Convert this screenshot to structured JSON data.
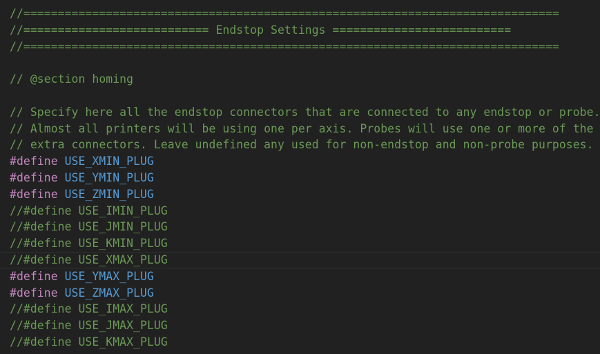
{
  "editor": {
    "background_color": "#212121",
    "comment_color": "#6a9955",
    "keyword_color": "#c586c0",
    "identifier_color": "#569cd6",
    "highlight_border_color": "#2c2f30",
    "section_title": "Endstop Settings",
    "section_tag": "// @section homing"
  },
  "lines": [
    {
      "id": "banner-top",
      "type": "comment",
      "text": "//=============================================================================="
    },
    {
      "id": "banner-title",
      "type": "comment",
      "text": "//=========================== Endstop Settings =========================="
    },
    {
      "id": "banner-bottom",
      "type": "comment",
      "text": "//=============================================================================="
    },
    {
      "id": "blank-1",
      "type": "blank",
      "text": " "
    },
    {
      "id": "section-homing",
      "type": "comment",
      "text": "// @section homing"
    },
    {
      "id": "blank-2",
      "type": "blank",
      "text": " "
    },
    {
      "id": "desc-1",
      "type": "comment",
      "text": "// Specify here all the endstop connectors that are connected to any endstop or probe."
    },
    {
      "id": "desc-2",
      "type": "comment",
      "text": "// Almost all printers will be using one per axis. Probes will use one or more of the"
    },
    {
      "id": "desc-3",
      "type": "comment",
      "text": "// extra connectors. Leave undefined any used for non-endstop and non-probe purposes."
    },
    {
      "id": "use-xmin-plug",
      "type": "define",
      "keyword": "#define",
      "identifier": "USE_XMIN_PLUG",
      "text": "#define USE_XMIN_PLUG"
    },
    {
      "id": "use-ymin-plug",
      "type": "define",
      "keyword": "#define",
      "identifier": "USE_YMIN_PLUG",
      "text": "#define USE_YMIN_PLUG"
    },
    {
      "id": "use-zmin-plug",
      "type": "define",
      "keyword": "#define",
      "identifier": "USE_ZMIN_PLUG",
      "text": "#define USE_ZMIN_PLUG"
    },
    {
      "id": "use-imin-plug",
      "type": "comment",
      "text": "//#define USE_IMIN_PLUG"
    },
    {
      "id": "use-jmin-plug",
      "type": "comment",
      "text": "//#define USE_JMIN_PLUG"
    },
    {
      "id": "use-kmin-plug",
      "type": "comment",
      "text": "//#define USE_KMIN_PLUG"
    },
    {
      "id": "use-xmax-plug",
      "type": "comment",
      "highlight": true,
      "text": "//#define USE_XMAX_PLUG"
    },
    {
      "id": "use-ymax-plug",
      "type": "define",
      "keyword": "#define",
      "identifier": "USE_YMAX_PLUG",
      "text": "#define USE_YMAX_PLUG"
    },
    {
      "id": "use-zmax-plug",
      "type": "define",
      "keyword": "#define",
      "identifier": "USE_ZMAX_PLUG",
      "text": "#define USE_ZMAX_PLUG"
    },
    {
      "id": "use-imax-plug",
      "type": "comment",
      "text": "//#define USE_IMAX_PLUG"
    },
    {
      "id": "use-jmax-plug",
      "type": "comment",
      "text": "//#define USE_JMAX_PLUG"
    },
    {
      "id": "use-kmax-plug",
      "type": "comment",
      "text": "//#define USE_KMAX_PLUG"
    }
  ]
}
